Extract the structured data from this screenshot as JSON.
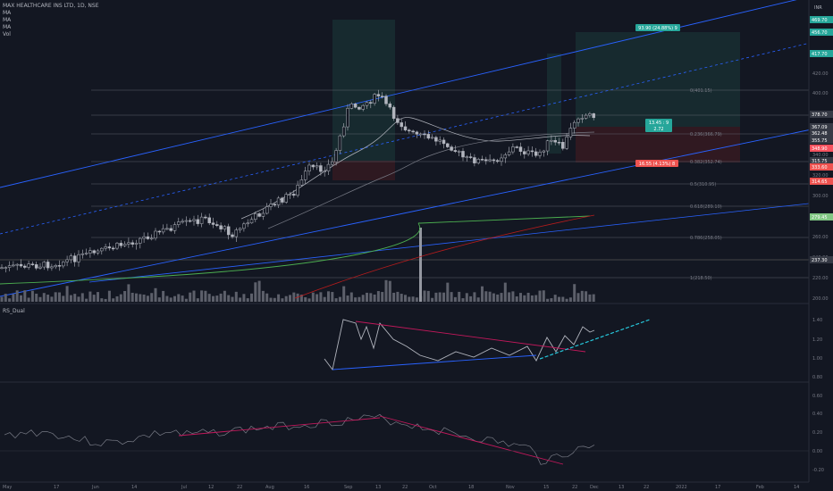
{
  "legend": {
    "symbol": "MAX HEALTHCARE INS LTD, 1D, NSE",
    "indicators": [
      "MA",
      "MA",
      "MA",
      "Vol"
    ]
  },
  "corner_label": "INR",
  "rsi_label": "RS_Dual",
  "price_axis": {
    "ticks": [
      "420.00",
      "400.00",
      "380.00",
      "360.00",
      "340.00",
      "320.00",
      "300.00",
      "280.00",
      "260.00",
      "240.00",
      "220.00",
      "200.00"
    ],
    "tags": [
      {
        "text": "469.70",
        "color": "#26a69a"
      },
      {
        "text": "456.70",
        "color": "#26a69a"
      },
      {
        "text": "417.70",
        "color": "#26a69a"
      },
      {
        "text": "378.70",
        "color": "#363a45"
      },
      {
        "text": "367.09",
        "color": "#363a45"
      },
      {
        "text": "362.48",
        "color": "#363a45"
      },
      {
        "text": "355.75",
        "color": "#363a45"
      },
      {
        "text": "348.90",
        "color": "#f7525f"
      },
      {
        "text": "315.75",
        "color": "#363a45"
      },
      {
        "text": "333.60",
        "color": "#ef5350"
      },
      {
        "text": "314.65",
        "color": "#ef5350"
      },
      {
        "text": "279.45",
        "color": "#81c784"
      },
      {
        "text": "237.30",
        "color": "#363a45"
      }
    ]
  },
  "fib_labels": [
    "0(401.15)",
    "0.236(366.79)",
    "0.382(352.74)",
    "0.5(310.95)",
    "0.618(289.10)",
    "0.786(258.05)",
    "1(218.50)"
  ],
  "long_position": {
    "target_label": "93.90 (24.88%) 9",
    "stop_label": "16.55 (4.13%) 8",
    "ratio_label": [
      "13.45 : 9",
      "2.72"
    ]
  },
  "rsi_axis": {
    "ticks": [
      "1.40",
      "1.20",
      "1.00",
      "0.80",
      "0.60"
    ]
  },
  "osc_axis": {
    "ticks": [
      "0.40",
      "0.20",
      "0.00",
      "-0.20"
    ]
  },
  "time_axis": {
    "labels": [
      "May",
      "17",
      "Jun",
      "14",
      "Jul",
      "12",
      "22",
      "Aug",
      "16",
      "Sep",
      "13",
      "22",
      "Oct",
      "18",
      "Nov",
      "15",
      "22",
      "Dec",
      "13",
      "22",
      "2022",
      "17",
      "Feb",
      "14"
    ]
  },
  "colors": {
    "background": "#131722",
    "bull": "#b2b5be",
    "bear": "#b2b5be",
    "channel": "#2962ff",
    "ma_long": "#4caf50",
    "ma_red": "#b71c1c",
    "target_zone": "#1b3b3a",
    "stop_zone": "#3b1b21",
    "rsi_line": "#b2b5be",
    "trend_pink": "#c2185b",
    "trend_cyan": "#26c6da"
  }
}
